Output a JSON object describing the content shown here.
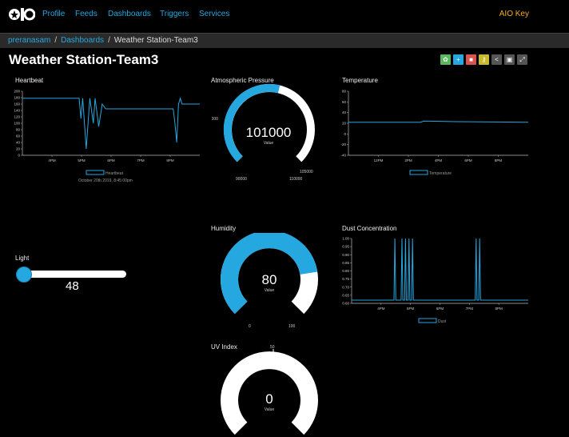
{
  "nav": {
    "profile": "Profile",
    "feeds": "Feeds",
    "dashboards": "Dashboards",
    "triggers": "Triggers",
    "services": "Services",
    "aio_key": "AIO Key"
  },
  "breadcrumb": {
    "user": "preranasam",
    "dashboards": "Dashboards",
    "current": "Weather Station-Team3"
  },
  "page_title": "Weather Station-Team3",
  "toolbar": {
    "icons": [
      "gear-icon",
      "plus-icon",
      "trash-icon",
      "key-icon",
      "share-icon",
      "lock-icon",
      "fullscreen-icon"
    ],
    "colors": [
      "#5cb85c",
      "#25a8e0",
      "#d9534f",
      "#c9b92f",
      "#555555",
      "#555555",
      "#555555"
    ]
  },
  "blocks": {
    "heartbeat": {
      "title": "Heartbeat",
      "legend": "Heartbeat",
      "timestamp": "October 20th 2019, 8:45:00pm"
    },
    "pressure": {
      "title": "Atmospheric Pressure",
      "value": "101000",
      "unit": "Value",
      "min_label": "90000",
      "mid_label": "95000",
      "max_label": "110000",
      "max_label2": "105000"
    },
    "temperature": {
      "title": "Temperature",
      "legend": "Temperature"
    },
    "light": {
      "title": "Light",
      "value": "48"
    },
    "humidity": {
      "title": "Humidity",
      "value": "80",
      "unit": "Value",
      "min_label": "0",
      "max_label": "100"
    },
    "dust": {
      "title": "Dust Concentration",
      "legend": "Dust"
    },
    "uv": {
      "title": "UV Index",
      "value": "0",
      "unit": "Value",
      "max_label": "50"
    }
  },
  "chart_data": [
    {
      "type": "line",
      "title": "Heartbeat",
      "yticks": [
        "200",
        "180",
        "160",
        "140",
        "120",
        "100",
        "80",
        "60",
        "40",
        "20",
        "0"
      ],
      "xticks": [
        "4PM",
        "5PM",
        "6PM",
        "7PM",
        "8PM"
      ],
      "ylim": [
        0,
        200
      ],
      "series": [
        {
          "name": "Heartbeat",
          "color": "#25a8e0",
          "x": [
            0,
            0.32,
            0.33,
            0.34,
            0.36,
            0.38,
            0.4,
            0.41,
            0.43,
            0.45,
            0.47,
            0.5,
            0.55,
            0.7,
            0.85,
            0.86,
            0.87,
            0.88,
            0.89,
            0.9,
            1.0
          ],
          "values": [
            178,
            178,
            115,
            178,
            20,
            178,
            100,
            178,
            90,
            160,
            145,
            145,
            145,
            145,
            145,
            100,
            40,
            160,
            178,
            160,
            160
          ]
        }
      ]
    },
    {
      "type": "line",
      "title": "Temperature",
      "yticks": [
        "80",
        "60",
        "40",
        "20",
        "0",
        "-20",
        "-40"
      ],
      "xticks": [
        "12PM",
        "2PM",
        "4PM",
        "6PM",
        "8PM"
      ],
      "ylim": [
        -40,
        80
      ],
      "series": [
        {
          "name": "Temperature",
          "color": "#25a8e0",
          "x": [
            0,
            0.4,
            0.42,
            0.6,
            1.0
          ],
          "values": [
            22,
            22,
            24,
            23,
            22
          ]
        }
      ]
    },
    {
      "type": "line",
      "title": "Dust Concentration",
      "yticks": [
        "1.00",
        "0.95",
        "0.90",
        "0.85",
        "0.80",
        "0.75",
        "0.70",
        "0.65",
        "0.60"
      ],
      "xticks": [
        "4PM",
        "5PM",
        "6PM",
        "7PM",
        "8PM"
      ],
      "ylim": [
        0.6,
        1.0
      ],
      "series": [
        {
          "name": "Dust",
          "color": "#25a8e0",
          "x": [
            0,
            0.24,
            0.245,
            0.25,
            0.28,
            0.285,
            0.29,
            0.3,
            0.305,
            0.31,
            0.32,
            0.325,
            0.33,
            0.34,
            0.345,
            0.35,
            0.7,
            0.705,
            0.71,
            0.72,
            0.725,
            0.73,
            1.0
          ],
          "values": [
            0.62,
            0.62,
            1.0,
            0.62,
            0.62,
            1.0,
            0.62,
            0.62,
            1.0,
            0.62,
            0.62,
            1.0,
            0.62,
            0.62,
            1.0,
            0.62,
            0.62,
            1.0,
            0.62,
            0.62,
            1.0,
            0.62,
            0.62
          ]
        }
      ]
    }
  ],
  "gauges": {
    "pressure": {
      "min": 90000,
      "max": 110000,
      "value": 101000,
      "color": "#25a8e0"
    },
    "humidity": {
      "min": 0,
      "max": 100,
      "value": 80,
      "color": "#25a8e0"
    },
    "uv": {
      "min": 0,
      "max": 50,
      "value": 0,
      "color": "#25a8e0"
    }
  },
  "slider": {
    "min": 0,
    "max": 100,
    "value": 48
  }
}
